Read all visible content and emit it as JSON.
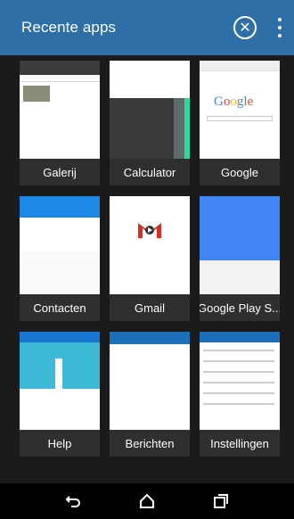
{
  "header": {
    "title": "Recente apps",
    "close_icon": "close-circle-icon",
    "more_icon": "more-vert-icon"
  },
  "apps": [
    {
      "label": "Galerij"
    },
    {
      "label": "Calculator"
    },
    {
      "label": "Google"
    },
    {
      "label": "Contacten"
    },
    {
      "label": "Gmail"
    },
    {
      "label": "Google Play S..."
    },
    {
      "label": "Help"
    },
    {
      "label": "Berichten"
    },
    {
      "label": "Instellingen"
    }
  ],
  "navbar": {
    "back_icon": "back-icon",
    "home_icon": "home-icon",
    "recents_icon": "recents-icon"
  },
  "colors": {
    "header_bg": "#2f6fa7",
    "background": "#1b1b1b",
    "card_bg": "#2f2f2f"
  }
}
